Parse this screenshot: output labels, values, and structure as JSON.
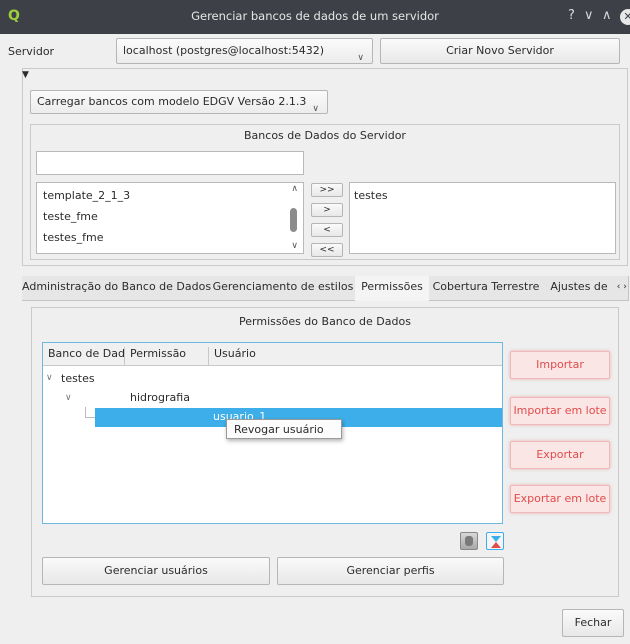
{
  "window": {
    "title": "Gerenciar bancos de dados de um servidor",
    "controls": {
      "help": "?",
      "minimize": "∨",
      "maximize": "∧",
      "close": "✕"
    }
  },
  "server": {
    "label": "Servidor",
    "selected": "localhost (postgres@localhost:5432)",
    "create_button": "Criar Novo Servidor"
  },
  "model_combo": "Carregar bancos com modelo EDGV Versão 2.1.3",
  "databases": {
    "title": "Bancos de Dados do Servidor",
    "filter_value": "",
    "available": [
      "template_2_1_3",
      "teste_fme",
      "testes_fme"
    ],
    "selected": [
      "testes"
    ],
    "transfer_buttons": [
      ">>",
      ">",
      "<",
      "<<"
    ]
  },
  "tabs": [
    {
      "label": "Administração do Banco de Dados",
      "active": false
    },
    {
      "label": "Gerenciamento de estilos",
      "active": false
    },
    {
      "label": "Permissões",
      "active": true
    },
    {
      "label": "Cobertura Terrestre",
      "active": false
    },
    {
      "label": "Ajustes de",
      "active": false
    }
  ],
  "tab_scroll": {
    "left": "‹",
    "right": "›"
  },
  "permissions": {
    "title": "Permissões do Banco de Dados",
    "columns": [
      "Banco de Dad",
      "Permissão",
      "Usuário"
    ],
    "tree": {
      "database": "testes",
      "permission": "hidrografia",
      "user": "usuario_1"
    },
    "context_menu": [
      "Revogar usuário"
    ],
    "side_buttons": [
      "Importar",
      "Importar em lote",
      "Exportar",
      "Exportar em lote"
    ],
    "bottom_buttons": [
      "Gerenciar usuários",
      "Gerenciar perfis"
    ]
  },
  "footer": {
    "close_button": "Fechar"
  },
  "colors": {
    "selection": "#3daee9",
    "danger": "#e14b4b",
    "titlebar": "#3d4147"
  }
}
